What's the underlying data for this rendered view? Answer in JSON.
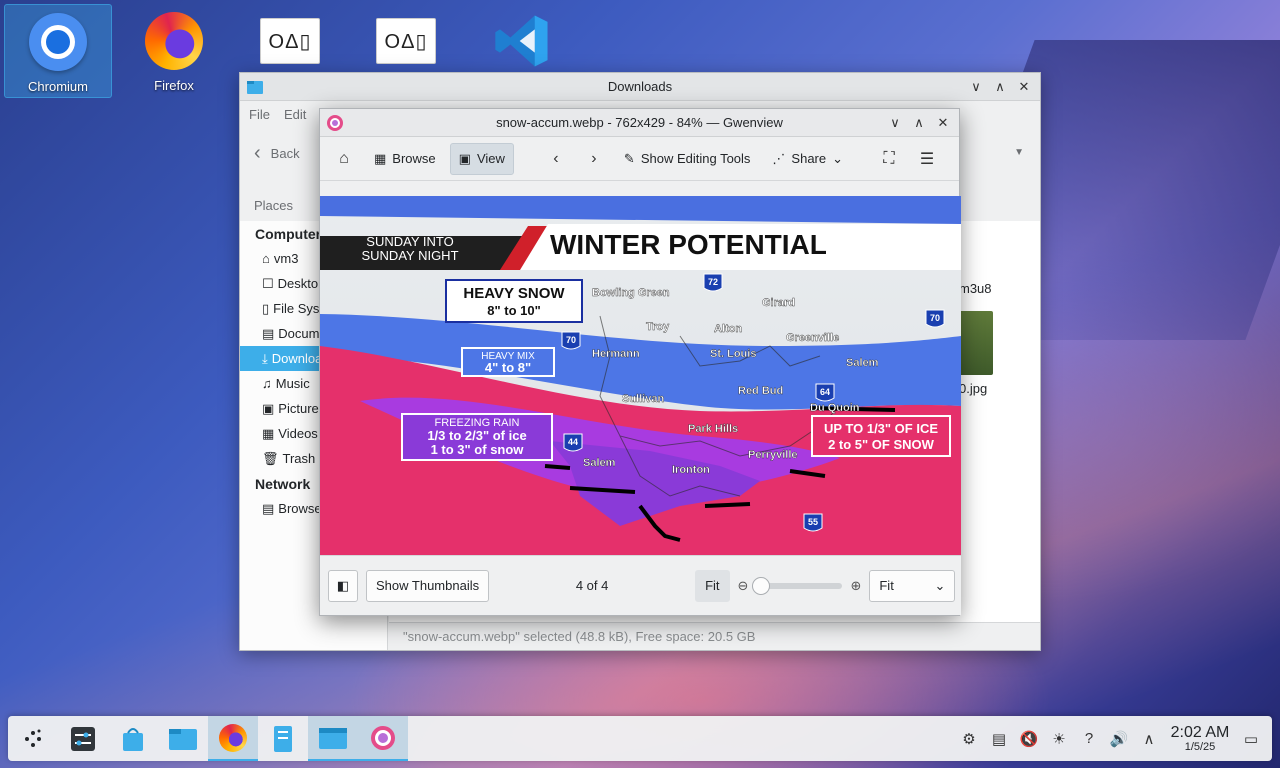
{
  "desktop": {
    "icons": [
      {
        "label": "Chromium",
        "icon": "chromium-icon"
      },
      {
        "label": "Firefox",
        "icon": "firefox-icon"
      },
      {
        "label": "",
        "icon": "app-shapes-icon"
      },
      {
        "label": "",
        "icon": "app-shapes-icon"
      },
      {
        "label": "",
        "icon": "vscode-icon"
      }
    ],
    "blank_icon_glyphs": "OΔ▯"
  },
  "dolphin": {
    "title": "Downloads",
    "menu": [
      "File",
      "Edit"
    ],
    "back_label": "Back",
    "places_header": "Places",
    "sidebar": {
      "computer_group": "Computer",
      "items": [
        {
          "label": "vm3",
          "icon": "home-icon"
        },
        {
          "label": "Desktop",
          "icon": "desktop-icon"
        },
        {
          "label": "File System",
          "icon": "drive-icon"
        },
        {
          "label": "Documents",
          "icon": "document-icon"
        },
        {
          "label": "Downloads",
          "icon": "download-icon",
          "active": true
        },
        {
          "label": "Music",
          "icon": "music-icon"
        },
        {
          "label": "Pictures",
          "icon": "picture-icon"
        },
        {
          "label": "Videos",
          "icon": "video-icon"
        },
        {
          "label": "Trash",
          "icon": "trash-icon"
        }
      ],
      "network_group": "Network",
      "network_items": [
        {
          "label": "Browse",
          "icon": "network-icon"
        }
      ]
    },
    "files_partial": [
      "m3u8",
      "0.jpg"
    ],
    "status": "\"snow-accum.webp\" selected (48.8 kB), Free space: 20.5 GB"
  },
  "gwenview": {
    "title": "snow-accum.webp - 762x429 - 84% — Gwenview",
    "toolbar": {
      "browse": "Browse",
      "view": "View",
      "editing": "Show Editing Tools",
      "share": "Share"
    },
    "bottom": {
      "thumbnails": "Show Thumbnails",
      "position": "4 of 4",
      "fit_button": "Fit",
      "zoom_select": "Fit"
    },
    "image": {
      "left_tag_line1": "SUNDAY INTO",
      "left_tag_line2": "SUNDAY NIGHT",
      "headline": "WINTER POTENTIAL",
      "boxes": {
        "heavy_snow_1": "HEAVY SNOW",
        "heavy_snow_2": "8\" to 10\"",
        "heavy_mix_1": "HEAVY MIX",
        "heavy_mix_2": "4\" to 8\"",
        "freezing_1": "FREEZING RAIN",
        "freezing_2": "1/3 to 2/3\" of ice",
        "freezing_3": "1 to 3\" of snow",
        "ice_1": "UP TO 1/3\" OF ICE",
        "ice_2": "2 to 5\" OF SNOW"
      },
      "cities": [
        "Bowling Green",
        "Girard",
        "Troy",
        "Alton",
        "Greenville",
        "Hermann",
        "St. Louis",
        "Salem",
        "Red Bud",
        "Sullivan",
        "Du Quoin",
        "Park Hills",
        "Perryville",
        "Salem",
        "Ironton"
      ],
      "shields": [
        "72",
        "70",
        "70",
        "64",
        "44",
        "55"
      ]
    }
  },
  "taskbar": {
    "clock_time": "2:02 AM",
    "clock_date": "1/5/25"
  },
  "colors": {
    "accent": "#3daee9",
    "snow_band": "#e8336f",
    "mix_band": "#3d6fe0",
    "ice_band": "#9b3de0"
  }
}
